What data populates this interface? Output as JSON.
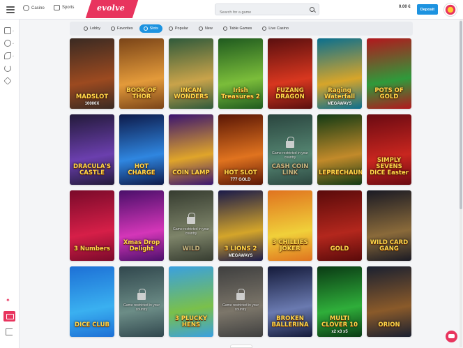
{
  "topbar": {
    "nav": [
      {
        "label": "Casino",
        "icon": "casino-chip-icon"
      },
      {
        "label": "Sports",
        "icon": "trophy-icon"
      }
    ],
    "logo": "evolve",
    "search_placeholder": "Search for a game",
    "balance": "0.00 €",
    "deposit_label": "Deposit"
  },
  "categories": [
    {
      "label": "Lobby",
      "icon": "lobby-icon",
      "active": false
    },
    {
      "label": "Favorites",
      "icon": "heart-icon",
      "active": false
    },
    {
      "label": "Slots",
      "icon": "slots-icon",
      "active": true
    },
    {
      "label": "Popular",
      "icon": "popular-icon",
      "active": false
    },
    {
      "label": "New",
      "icon": "new-icon",
      "active": false
    },
    {
      "label": "Table Games",
      "icon": "table-games-icon",
      "active": false
    },
    {
      "label": "Live Casino",
      "icon": "live-casino-icon",
      "active": false
    }
  ],
  "restricted_text": "Game restricted in your country",
  "games": [
    {
      "name": "MADSLOT",
      "sub": "10000X",
      "bg": "#3a2a22",
      "bg2": "#9c4a20",
      "restricted": false
    },
    {
      "name": "BOOK OF THOR",
      "sub": "",
      "bg": "#7a4418",
      "bg2": "#e39a3a",
      "restricted": false
    },
    {
      "name": "INCAN WONDERS",
      "sub": "",
      "bg": "#2f5a3b",
      "bg2": "#c9a34a",
      "restricted": false
    },
    {
      "name": "Irish Treasures 2",
      "sub": "",
      "bg": "#1f5a1f",
      "bg2": "#7bbd3a",
      "restricted": false
    },
    {
      "name": "FUZANG DRAGON",
      "sub": "",
      "bg": "#5a0f0f",
      "bg2": "#d8371f",
      "restricted": false
    },
    {
      "name": "Raging Waterfall",
      "sub": "MEGAWAYS",
      "bg": "#0a6f8f",
      "bg2": "#d7a52a",
      "restricted": false
    },
    {
      "name": "POTS OF GOLD",
      "sub": "",
      "bg": "#b3171d",
      "bg2": "#2f9a3b",
      "restricted": false
    },
    {
      "name": "DRACULA'S CASTLE",
      "sub": "",
      "bg": "#231a3a",
      "bg2": "#6b3fae",
      "restricted": false
    },
    {
      "name": "HOT CHARGE",
      "sub": "",
      "bg": "#0d1a4a",
      "bg2": "#2f86e0",
      "restricted": false
    },
    {
      "name": "COIN LAMP",
      "sub": "",
      "bg": "#3a1470",
      "bg2": "#e0a52a",
      "restricted": false
    },
    {
      "name": "HOT SLOT",
      "sub": "777 GOLD",
      "bg": "#5a1605",
      "bg2": "#e0731f",
      "restricted": false
    },
    {
      "name": "CASH COIN LINK",
      "sub": "",
      "bg": "#145a4a",
      "bg2": "#2fae7a",
      "restricted": true
    },
    {
      "name": "LEPRECHAUN",
      "sub": "",
      "bg": "#123a14",
      "bg2": "#c28a2a",
      "restricted": false
    },
    {
      "name": "SIMPLY SEVENS DICE Easter",
      "sub": "",
      "bg": "#6a0a12",
      "bg2": "#c8261f",
      "restricted": false
    },
    {
      "name": "3 Numbers",
      "sub": "",
      "bg": "#7a0a2a",
      "bg2": "#d61f48",
      "restricted": false
    },
    {
      "name": "Xmas Drop Delight",
      "sub": "",
      "bg": "#4a0f6a",
      "bg2": "#d436b8",
      "restricted": false
    },
    {
      "name": "WILD",
      "sub": "",
      "bg": "#3a4a2a",
      "bg2": "#8fa05a",
      "restricted": true
    },
    {
      "name": "3 LIONS 2",
      "sub": "MEGAWAYS",
      "bg": "#1a1a4a",
      "bg2": "#d4a52a",
      "restricted": false
    },
    {
      "name": "3 CHILLIES JOKER",
      "sub": "",
      "bg": "#e0731f",
      "bg2": "#f0d03a",
      "restricted": false
    },
    {
      "name": "GOLD",
      "sub": "",
      "bg": "#5a0a0a",
      "bg2": "#b3271d",
      "restricted": false
    },
    {
      "name": "WILD CARD GANG",
      "sub": "",
      "bg": "#1a1a24",
      "bg2": "#8a6a3a",
      "restricted": false
    },
    {
      "name": "DICE CLUB",
      "sub": "",
      "bg": "#1d70d6",
      "bg2": "#3ab0f0",
      "restricted": false
    },
    {
      "name": "",
      "sub": "",
      "bg": "#1f5a6a",
      "bg2": "#5ab0a0",
      "restricted": true
    },
    {
      "name": "3 PLUCKY HENS",
      "sub": "",
      "bg": "#3aa0e0",
      "bg2": "#7ac04a",
      "restricted": false
    },
    {
      "name": "",
      "sub": "",
      "bg": "#4a4a4a",
      "bg2": "#9a8a6a",
      "restricted": true
    },
    {
      "name": "BROKEN BALLERINA",
      "sub": "",
      "bg": "#141a3a",
      "bg2": "#6a7ab0",
      "restricted": false
    },
    {
      "name": "MULTI CLOVER 10",
      "sub": "x2 x3 x5",
      "bg": "#0a3a14",
      "bg2": "#2fae3a",
      "restricted": false
    },
    {
      "name": "ORION",
      "sub": "",
      "bg": "#1a2030",
      "bg2": "#8a5a2a",
      "restricted": false
    }
  ]
}
